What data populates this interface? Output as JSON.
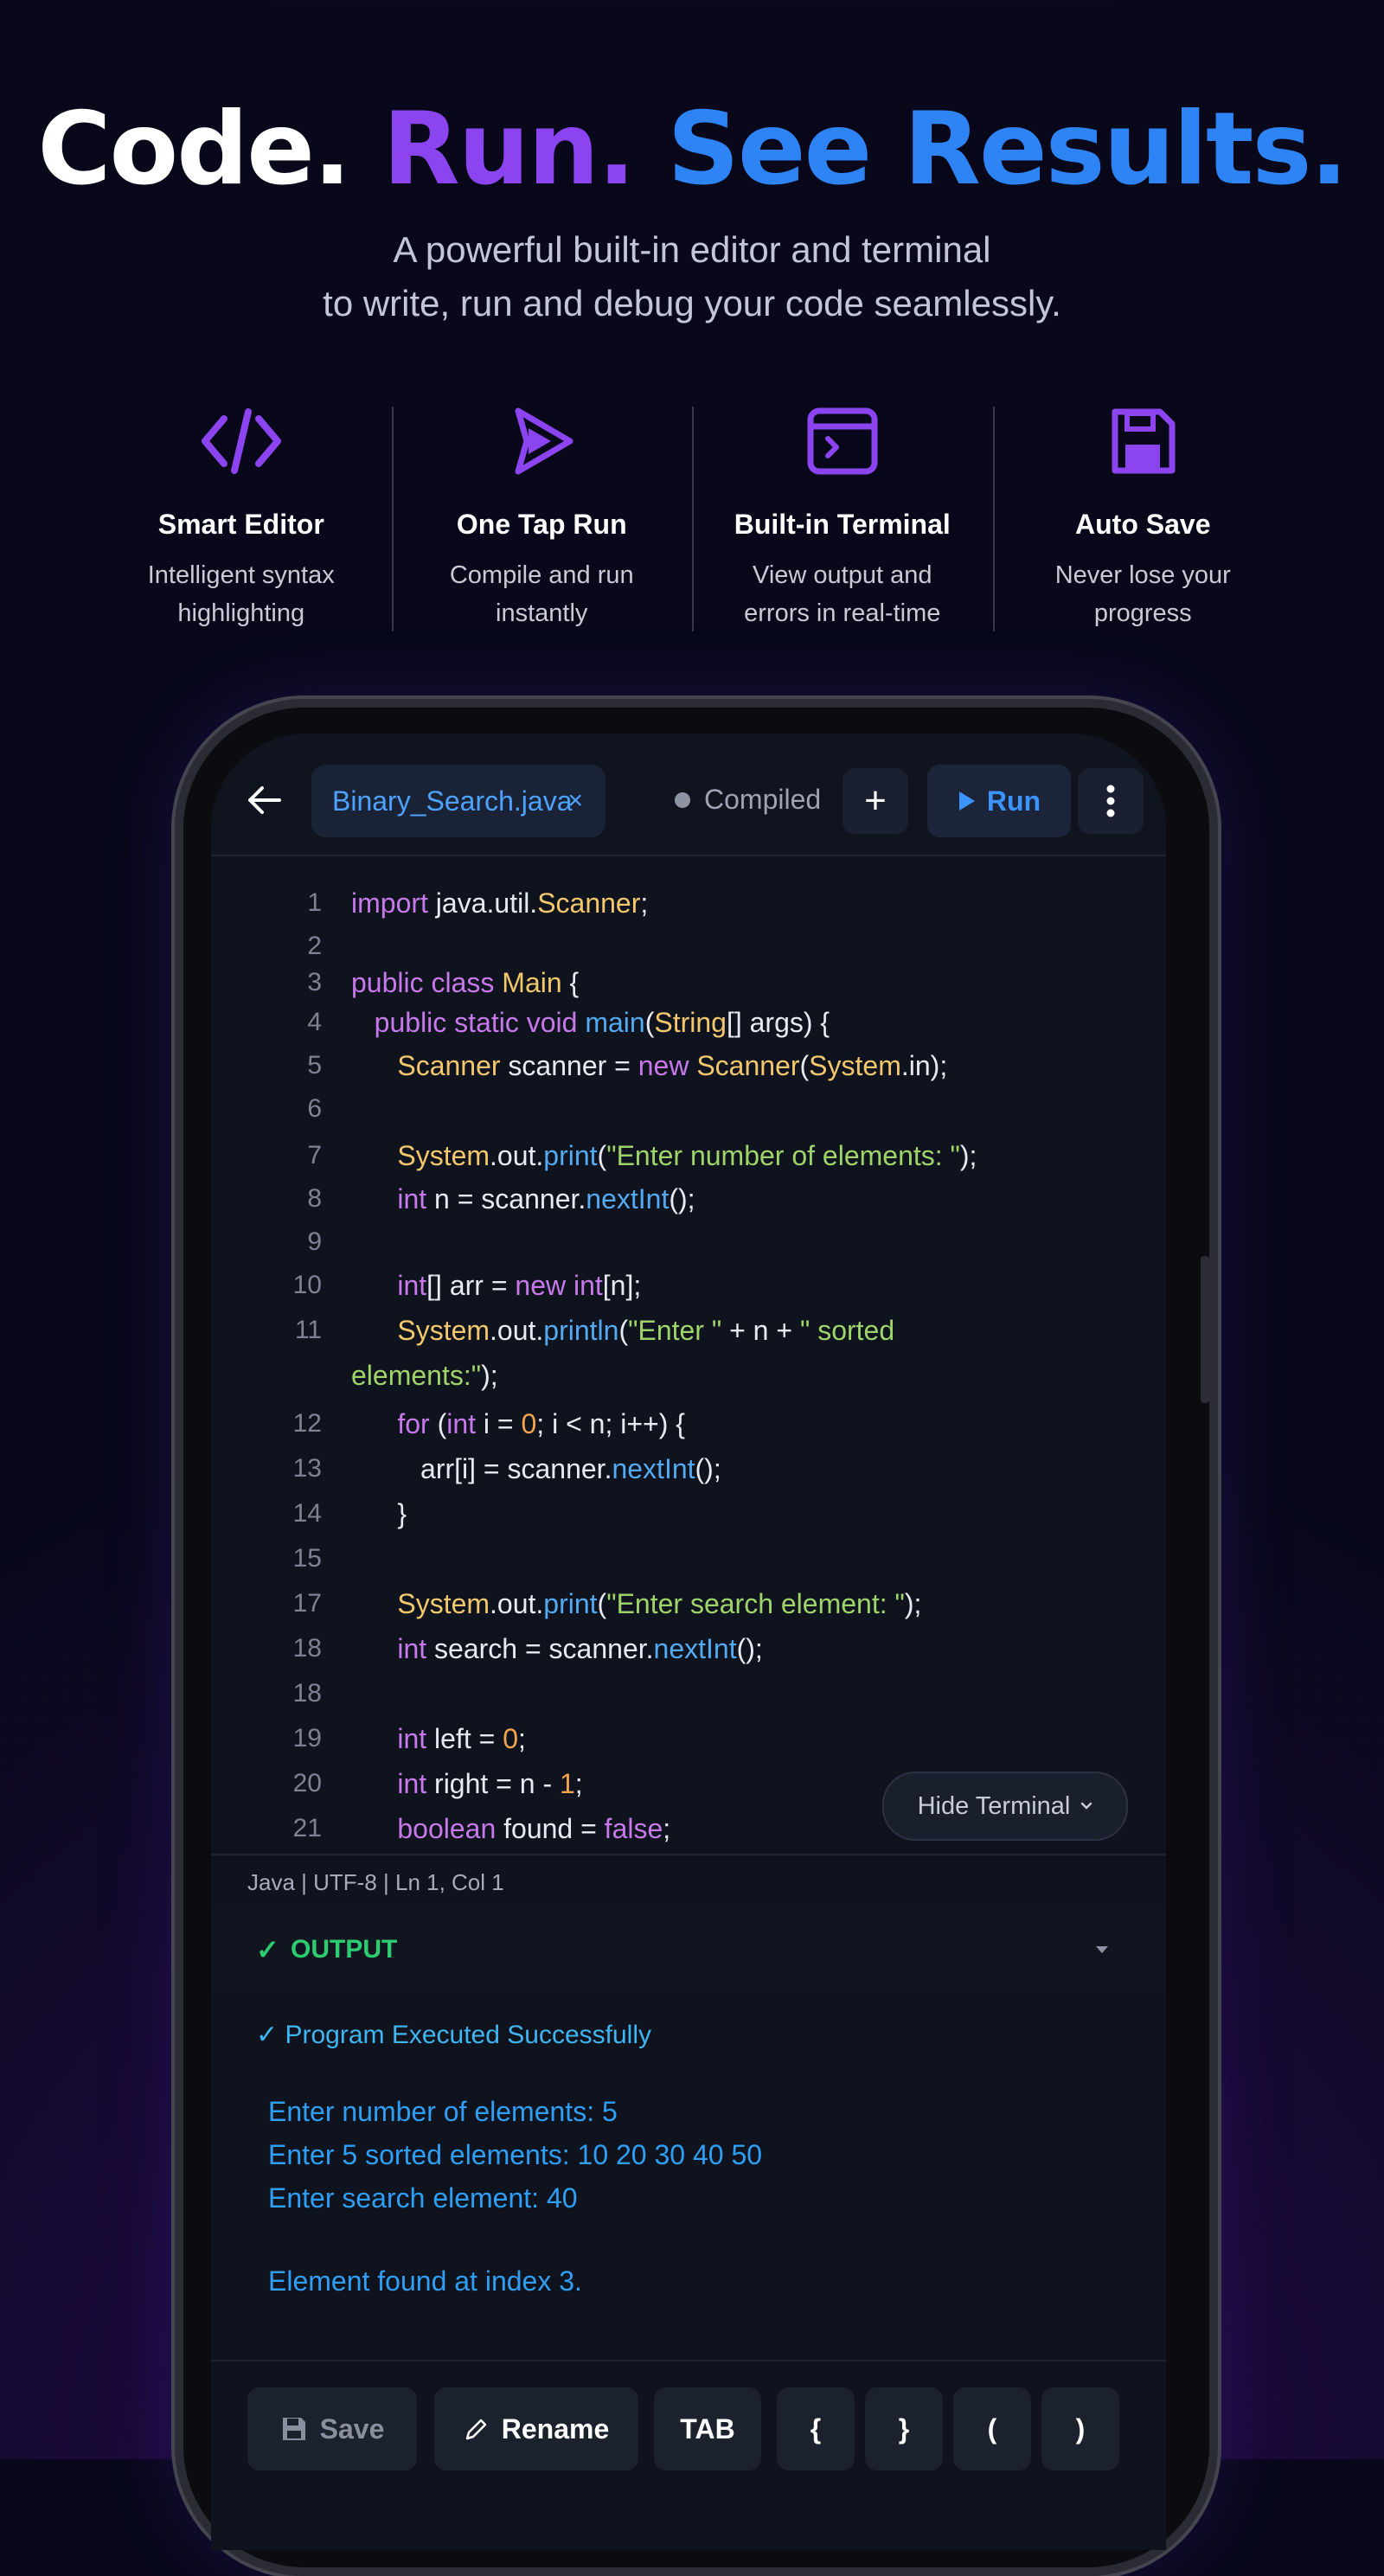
{
  "hero": {
    "title_code": "Code.",
    "title_run": "Run.",
    "title_see": "See Results.",
    "subtitle_line1": "A powerful built-in editor and terminal",
    "subtitle_line2": "to write, run and debug your code seamlessly."
  },
  "features": [
    {
      "icon": "code-icon",
      "title": "Smart Editor",
      "desc1": "Intelligent syntax",
      "desc2": "highlighting"
    },
    {
      "icon": "play-icon",
      "title": "One Tap Run",
      "desc1": "Compile and run",
      "desc2": "instantly"
    },
    {
      "icon": "terminal-icon",
      "title": "Built-in Terminal",
      "desc1": "View output and",
      "desc2": "errors in real-time"
    },
    {
      "icon": "save-icon",
      "title": "Auto Save",
      "desc1": "Never lose your",
      "desc2": "progress"
    }
  ],
  "editor": {
    "file_name": "Binary_Search.java",
    "close_glyph": "×",
    "status": "Compiled",
    "plus_glyph": "+",
    "run_label": "Run",
    "line_numbers": [
      "1",
      "2",
      "3",
      "4",
      "5",
      "6",
      "7",
      "8",
      "9",
      "10",
      "11",
      "12",
      "13",
      "14",
      "15",
      "17",
      "18",
      "18",
      "19",
      "20",
      "21"
    ]
  },
  "statusbar": {
    "text": "Java | UTF-8 | Ln 1, Col 1"
  },
  "terminal": {
    "hide_label": "Hide Terminal",
    "output_label": "OUTPUT",
    "check": "✓",
    "success": "✓ Program Executed Successfully",
    "lines": [
      "Enter number of elements: 5",
      "Enter 5 sorted elements: 10 20 30 40 50",
      "Enter search element: 40",
      "Element found at index 3."
    ]
  },
  "keys": {
    "save": "Save",
    "rename": "Rename",
    "tab": "TAB",
    "lbrace": "{",
    "rbrace": "}",
    "lparen": "(",
    "rparen": ")"
  },
  "colors": {
    "accent_purple": "#8b44f0",
    "accent_blue": "#2f84f5",
    "success_green": "#2ecc71"
  }
}
